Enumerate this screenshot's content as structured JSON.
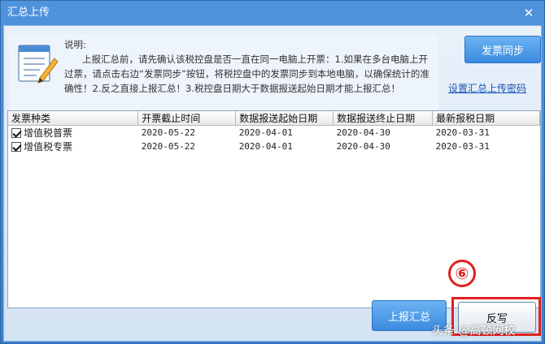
{
  "window": {
    "title": "汇总上传",
    "close_glyph": "✕"
  },
  "info": {
    "title": "说明:",
    "body": "上报汇总前，请先确认该税控盘是否一直在同一电脑上开票：1.如果在多台电脑上开过票，请点击右边“发票同步”按钮，将税控盘中的发票同步到本地电脑，以确保统计的准确性！2.反之直接上报汇总！3.税控盘日期大于数据报送起始日期才能上报汇总！"
  },
  "actions": {
    "sync_label": "发票同步",
    "password_link": "设置汇总上传密码",
    "upload_label": "上报汇总",
    "reverse_label": "反写"
  },
  "table": {
    "columns": [
      "发票种类",
      "开票截止时间",
      "数据报送起始日期",
      "数据报送终止日期",
      "最新报税日期"
    ],
    "rows": [
      {
        "type": "增值税普票",
        "checked": true,
        "deadline": "2020-05-22",
        "start": "2020-04-01",
        "end": "2020-04-30",
        "latest": "2020-03-31"
      },
      {
        "type": "增值税专票",
        "checked": true,
        "deadline": "2020-05-22",
        "start": "2020-04-01",
        "end": "2020-04-30",
        "latest": "2020-03-31"
      }
    ]
  },
  "annotation": {
    "step_badge": "⑥",
    "highlight_color": "#e02020"
  },
  "watermark": "头条 @高顿网校"
}
